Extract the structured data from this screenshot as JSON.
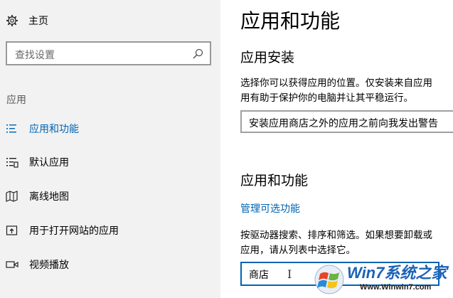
{
  "sidebar": {
    "home_label": "主页",
    "search_placeholder": "查找设置",
    "section_label": "应用",
    "items": [
      {
        "label": "应用和功能",
        "active": true,
        "icon": "apps-list-icon"
      },
      {
        "label": "默认应用",
        "active": false,
        "icon": "default-apps-icon"
      },
      {
        "label": "离线地图",
        "active": false,
        "icon": "offline-maps-icon"
      },
      {
        "label": "用于打开网站的应用",
        "active": false,
        "icon": "apps-for-websites-icon"
      },
      {
        "label": "视频播放",
        "active": false,
        "icon": "video-playback-icon"
      }
    ]
  },
  "main": {
    "title": "应用和功能",
    "install_heading": "应用安装",
    "install_desc_line1": "选择你可以获得应用的位置。仅安装来自应用",
    "install_desc_line2": "用有助于保护你的电脑并让其平稳运行。",
    "install_dropdown_value": "安装应用商店之外的应用之前向我发出警告",
    "apps_heading": "应用和功能",
    "manage_optional_link": "管理可选功能",
    "apps_desc_line1": "按驱动器搜索、排序和筛选。如果想要卸载或",
    "apps_desc_line2": "应用，请从列表中选择它。",
    "filter_value": "商店"
  },
  "watermark": {
    "title": "Win7系统之家",
    "url": "Www.Winwin7.com"
  },
  "colors": {
    "accent": "#0063b1",
    "sidebar_bg": "#f2f2f2"
  }
}
